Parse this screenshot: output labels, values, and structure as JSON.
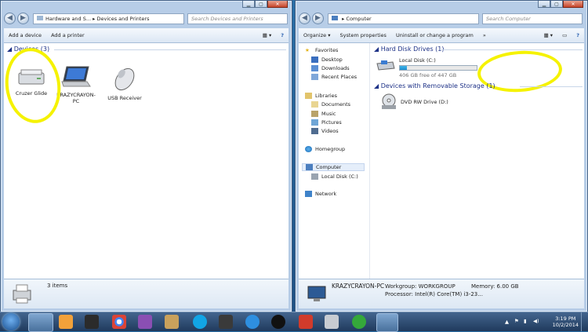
{
  "left_window": {
    "breadcrumb": [
      "Hardware and S...",
      "Devices and Printers"
    ],
    "search_placeholder": "Search Devices and Printers",
    "toolbar": {
      "add_device": "Add a device",
      "add_printer": "Add a printer"
    },
    "group": "Devices (3)",
    "devices": [
      {
        "label": "Cruzer Glide",
        "icon": "usb-drive-icon"
      },
      {
        "label": "KRAZYCRAYON-PC",
        "icon": "laptop-icon"
      },
      {
        "label": "USB Receiver",
        "icon": "mouse-icon"
      }
    ],
    "status": "3 items"
  },
  "right_window": {
    "breadcrumb": [
      "Computer"
    ],
    "search_placeholder": "Search Computer",
    "toolbar": {
      "organize": "Organize",
      "system_properties": "System properties",
      "uninstall": "Uninstall or change a program"
    },
    "nav": {
      "favorites": "Favorites",
      "desktop": "Desktop",
      "downloads": "Downloads",
      "recent": "Recent Places",
      "libraries": "Libraries",
      "documents": "Documents",
      "music": "Music",
      "pictures": "Pictures",
      "videos": "Videos",
      "homegroup": "Homegroup",
      "computer": "Computer",
      "local_disk": "Local Disk (C:)",
      "network": "Network"
    },
    "hdd_group": "Hard Disk Drives (1)",
    "local_disk": {
      "name": "Local Disk (C:)",
      "free": "406 GB free of 447 GB",
      "used_fraction": 0.09
    },
    "removable_group": "Devices with Removable Storage (1)",
    "dvd": "DVD RW Drive (D:)",
    "details": {
      "name": "KRAZYCRAYON-PC",
      "workgroup": "Workgroup: WORKGROUP",
      "memory": "Memory: 6.00 GB",
      "processor": "Processor: Intel(R) Core(TM) i3-23..."
    }
  },
  "taskbar": {
    "time": "3:19 PM",
    "date": "10/2/2014"
  },
  "colors": {
    "highlight": "#f5f200",
    "group_heading": "#1e3287"
  }
}
